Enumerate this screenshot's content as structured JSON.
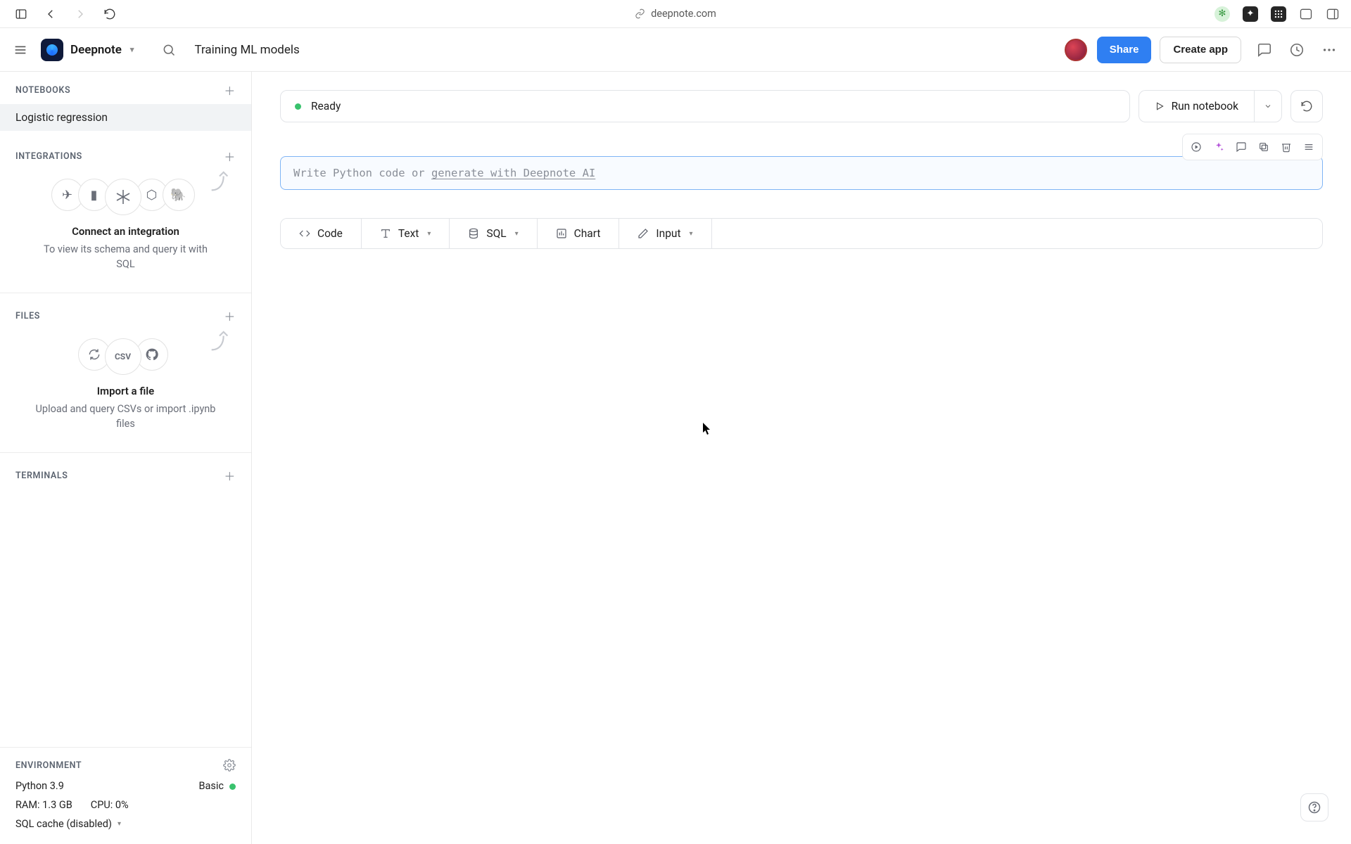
{
  "browser": {
    "url": "deepnote.com"
  },
  "header": {
    "brand": "Deepnote",
    "title": "Training ML models",
    "share": "Share",
    "create_app": "Create app"
  },
  "sidebar": {
    "notebooks_label": "NOTEBOOKS",
    "notebooks": [
      "Logistic regression"
    ],
    "integrations_label": "INTEGRATIONS",
    "integrations_cta": "Connect an integration",
    "integrations_sub": "To view its schema and query it with SQL",
    "files_label": "FILES",
    "files_cta": "Import a file",
    "files_sub": "Upload and query CSVs or import .ipynb files",
    "terminals_label": "TERMINALS"
  },
  "env": {
    "label": "ENVIRONMENT",
    "python": "Python 3.9",
    "tier": "Basic",
    "ram": "RAM: 1.3 GB",
    "cpu": "CPU: 0%",
    "sql": "SQL cache (disabled)"
  },
  "workspace": {
    "status": "Ready",
    "run": "Run notebook",
    "cell_prompt_prefix": "Write Python code or ",
    "cell_prompt_link": "generate with Deepnote AI",
    "add": {
      "code": "Code",
      "text": "Text",
      "sql": "SQL",
      "chart": "Chart",
      "input": "Input"
    }
  }
}
